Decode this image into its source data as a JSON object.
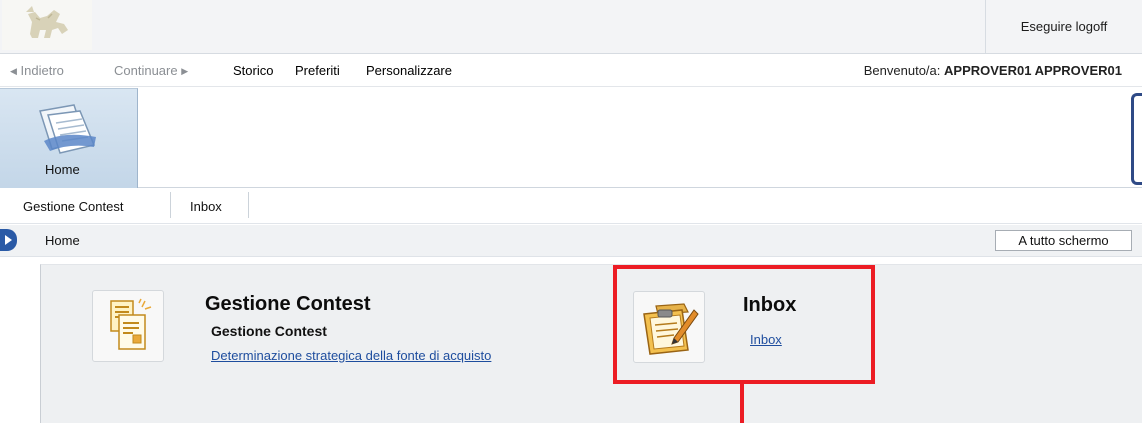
{
  "header": {
    "logo_name": "eni dog logo",
    "logoff_label": "Eseguire logoff"
  },
  "nav": {
    "back_label": "Indietro",
    "forward_label": "Continuare",
    "history_label": "Storico",
    "favorites_label": "Preferiti",
    "personalize_label": "Personalizzare",
    "welcome_prefix": "Benvenuto/a:",
    "user_name": "APPROVER01 APPROVER01"
  },
  "launchpad": {
    "home_label": "Home"
  },
  "subnav": {
    "items": [
      "Gestione Contest",
      "Inbox"
    ]
  },
  "breadcrumb": {
    "current": "Home",
    "fullscreen_label": "A tutto schermo"
  },
  "tiles": [
    {
      "title": "Gestione Contest",
      "subtitle": "Gestione Contest",
      "link": "Determinazione strategica della fonte di acquisto"
    },
    {
      "title": "Inbox",
      "link": "Inbox"
    }
  ],
  "colors": {
    "highlight": "#ec1c24",
    "link": "#1e4d9e",
    "toggle": "#2a5aa6"
  }
}
